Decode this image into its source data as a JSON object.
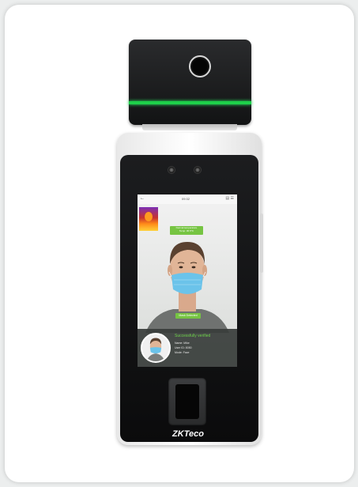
{
  "device": {
    "brand_logo": "ZKTeco",
    "colors": {
      "indicator_strip": "#1ed04a",
      "tag_green": "#76c442",
      "body_black": "#111213"
    }
  },
  "screen": {
    "status_time": "09:32",
    "back_icon": "back-arrow-icon",
    "temperature_tag": [
      "Normal temperature",
      "Temp: 36.5°C"
    ],
    "mask_tag": "Mask Detected",
    "result": {
      "title": "Successfully verified",
      "lines": [
        "Name: Mike",
        "User ID: 8050",
        "Mode: Face"
      ]
    }
  }
}
